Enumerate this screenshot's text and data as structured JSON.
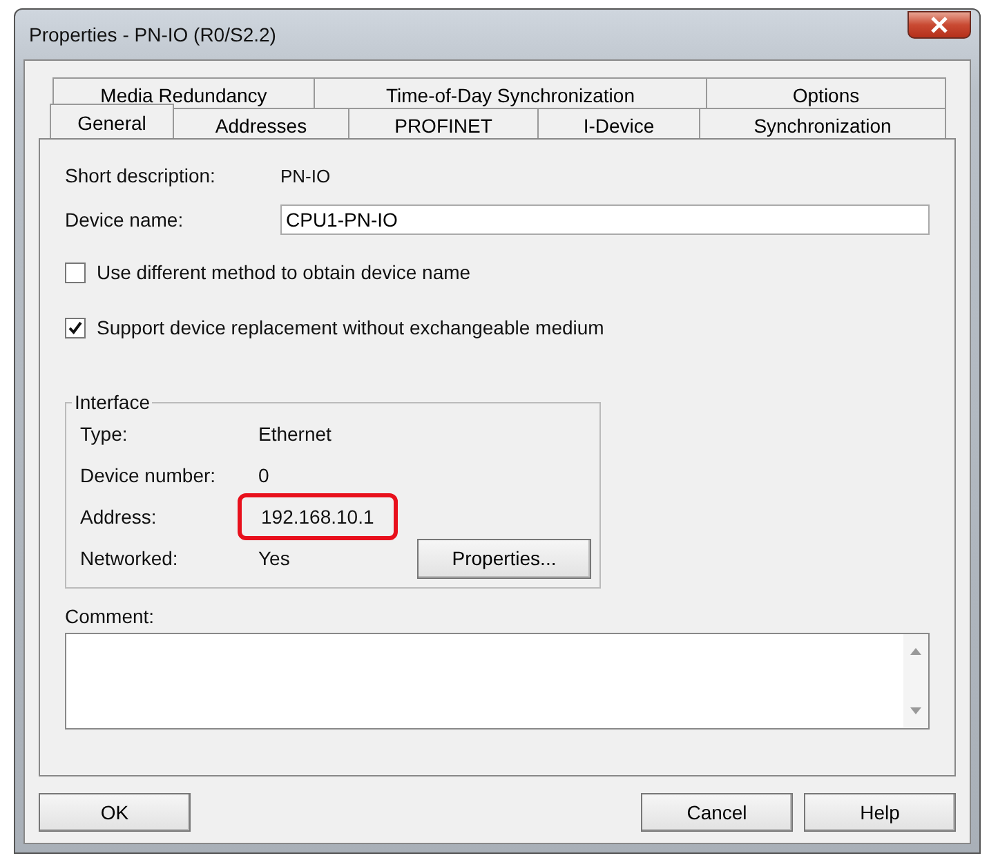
{
  "window": {
    "title": "Properties - PN-IO (R0/S2.2)"
  },
  "tab_rows": [
    [
      {
        "label": "Media Redundancy",
        "selected": false
      },
      {
        "label": "Time-of-Day Synchronization",
        "selected": false
      },
      {
        "label": "Options",
        "selected": false
      }
    ],
    [
      {
        "label": "General",
        "selected": true
      },
      {
        "label": "Addresses",
        "selected": false
      },
      {
        "label": "PROFINET",
        "selected": false
      },
      {
        "label": "I-Device",
        "selected": false
      },
      {
        "label": "Synchronization",
        "selected": false
      }
    ]
  ],
  "short_description": {
    "label": "Short description:",
    "value": "PN-IO"
  },
  "device_name": {
    "label": "Device name:",
    "value": "CPU1-PN-IO"
  },
  "checkboxes": [
    {
      "label": "Use different method to obtain device name",
      "checked": false
    },
    {
      "label": "Support device replacement without exchangeable medium",
      "checked": true
    }
  ],
  "interface": {
    "title": "Interface",
    "rows": [
      {
        "label": "Type:",
        "value": "Ethernet",
        "highlighted": false
      },
      {
        "label": "Device number:",
        "value": "0",
        "highlighted": false
      },
      {
        "label": "Address:",
        "value": "192.168.10.1",
        "highlighted": true
      },
      {
        "label": "Networked:",
        "value": "Yes",
        "highlighted": false
      }
    ],
    "button": "Properties..."
  },
  "comment": {
    "label": "Comment:"
  },
  "buttons": {
    "ok": "OK",
    "cancel": "Cancel",
    "help": "Help"
  }
}
